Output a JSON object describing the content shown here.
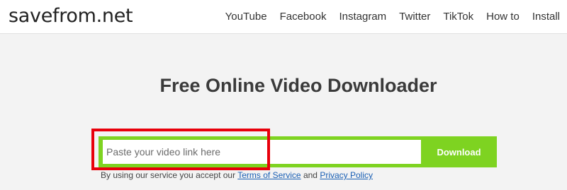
{
  "header": {
    "logo": "savefrom.net",
    "nav": [
      {
        "label": "YouTube"
      },
      {
        "label": "Facebook"
      },
      {
        "label": "Instagram"
      },
      {
        "label": "Twitter"
      },
      {
        "label": "TikTok"
      },
      {
        "label": "How to"
      },
      {
        "label": "Install"
      }
    ]
  },
  "main": {
    "title": "Free Online Video Downloader",
    "search": {
      "value": "",
      "placeholder": "Paste your video link here",
      "button_label": "Download"
    },
    "terms": {
      "prefix": "By using our service you accept our",
      "terms_link": "Terms of Service",
      "conjunction": "and",
      "privacy_link": "Privacy Policy"
    }
  },
  "colors": {
    "accent": "#7ed321",
    "highlight": "#e8000b",
    "link": "#1a5fb4",
    "background": "#f3f3f3"
  }
}
